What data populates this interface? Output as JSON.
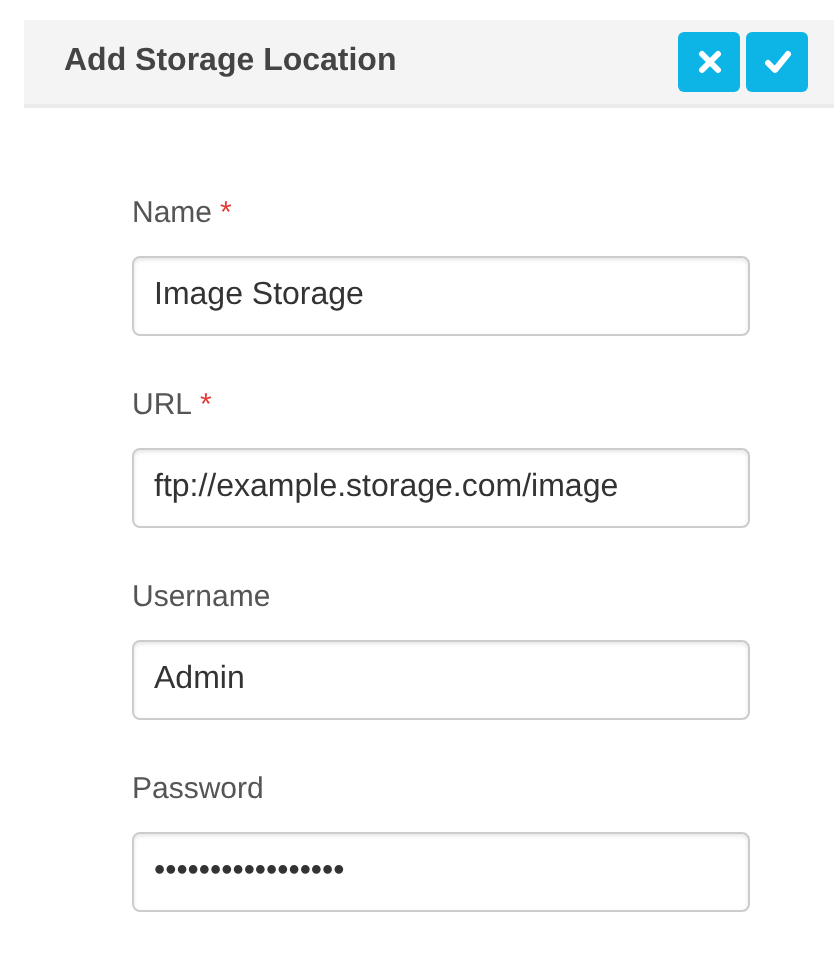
{
  "header": {
    "title": "Add Storage Location",
    "buttons": [
      {
        "kind": "cancel"
      },
      {
        "kind": "confirm"
      }
    ]
  },
  "fields": [
    {
      "label": "Name",
      "required_marker": "*",
      "value": "Image Storage"
    },
    {
      "label": "URL",
      "required_marker": "*",
      "value": "ftp://example.storage.com/image"
    },
    {
      "label": "Username",
      "value": "Admin"
    },
    {
      "label": "Password",
      "value": "•••••••••••••••••"
    }
  ]
}
